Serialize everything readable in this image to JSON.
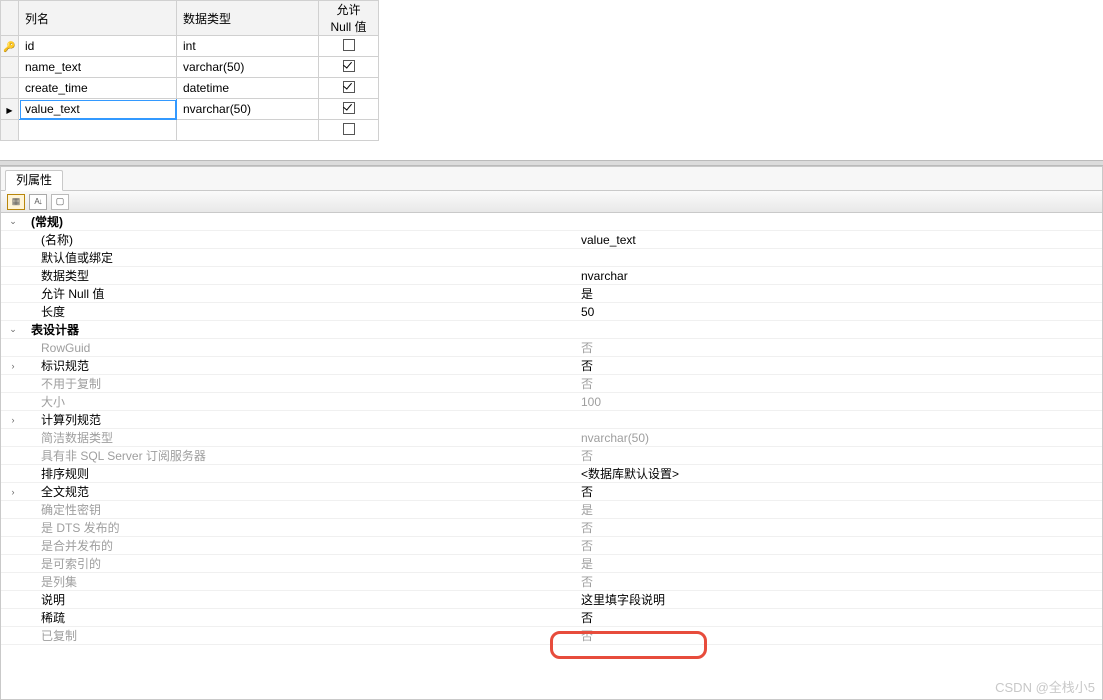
{
  "grid": {
    "headers": {
      "name": "列名",
      "type": "数据类型",
      "null": "允许 Null 值"
    },
    "rows": [
      {
        "marker": "key",
        "name": "id",
        "type": "int",
        "null": false
      },
      {
        "marker": "",
        "name": "name_text",
        "type": "varchar(50)",
        "null": true
      },
      {
        "marker": "",
        "name": "create_time",
        "type": "datetime",
        "null": true
      },
      {
        "marker": "arrow",
        "name": "value_text",
        "type": "nvarchar(50)",
        "null": true
      },
      {
        "marker": "",
        "name": "",
        "type": "",
        "null": false
      }
    ]
  },
  "tab_label": "列属性",
  "props": [
    {
      "kind": "cat",
      "exp": "open",
      "key": "(常规)",
      "val": ""
    },
    {
      "kind": "row",
      "key": "(名称)",
      "val": "value_text"
    },
    {
      "kind": "row",
      "key": "默认值或绑定",
      "val": ""
    },
    {
      "kind": "row",
      "key": "数据类型",
      "val": "nvarchar"
    },
    {
      "kind": "row",
      "key": "允许 Null 值",
      "val": "是"
    },
    {
      "kind": "row",
      "key": "长度",
      "val": "50"
    },
    {
      "kind": "cat",
      "exp": "open",
      "key": "表设计器",
      "val": ""
    },
    {
      "kind": "dis",
      "key": "RowGuid",
      "val": "否"
    },
    {
      "kind": "row",
      "exp": "closed",
      "key": "标识规范",
      "val": "否"
    },
    {
      "kind": "dis",
      "key": "不用于复制",
      "val": "否"
    },
    {
      "kind": "dis",
      "key": "大小",
      "val": "100"
    },
    {
      "kind": "row",
      "exp": "closed",
      "key": "计算列规范",
      "val": ""
    },
    {
      "kind": "dis",
      "key": "简洁数据类型",
      "val": "nvarchar(50)"
    },
    {
      "kind": "dis",
      "key": "具有非 SQL Server 订阅服务器",
      "val": "否"
    },
    {
      "kind": "row",
      "key": "排序规则",
      "val": "<数据库默认设置>"
    },
    {
      "kind": "row",
      "exp": "closed",
      "key": "全文规范",
      "val": "否"
    },
    {
      "kind": "dis",
      "key": "确定性密钥",
      "val": "是"
    },
    {
      "kind": "dis",
      "key": "是 DTS 发布的",
      "val": "否"
    },
    {
      "kind": "dis",
      "key": "是合并发布的",
      "val": "否"
    },
    {
      "kind": "dis",
      "key": "是可索引的",
      "val": "是"
    },
    {
      "kind": "dis",
      "key": "是列集",
      "val": "否"
    },
    {
      "kind": "row",
      "key": "说明",
      "val": "这里填字段说明"
    },
    {
      "kind": "row",
      "key": "稀疏",
      "val": "否"
    },
    {
      "kind": "dis",
      "key": "已复制",
      "val": "否"
    }
  ],
  "watermark": "CSDN @全栈小5"
}
